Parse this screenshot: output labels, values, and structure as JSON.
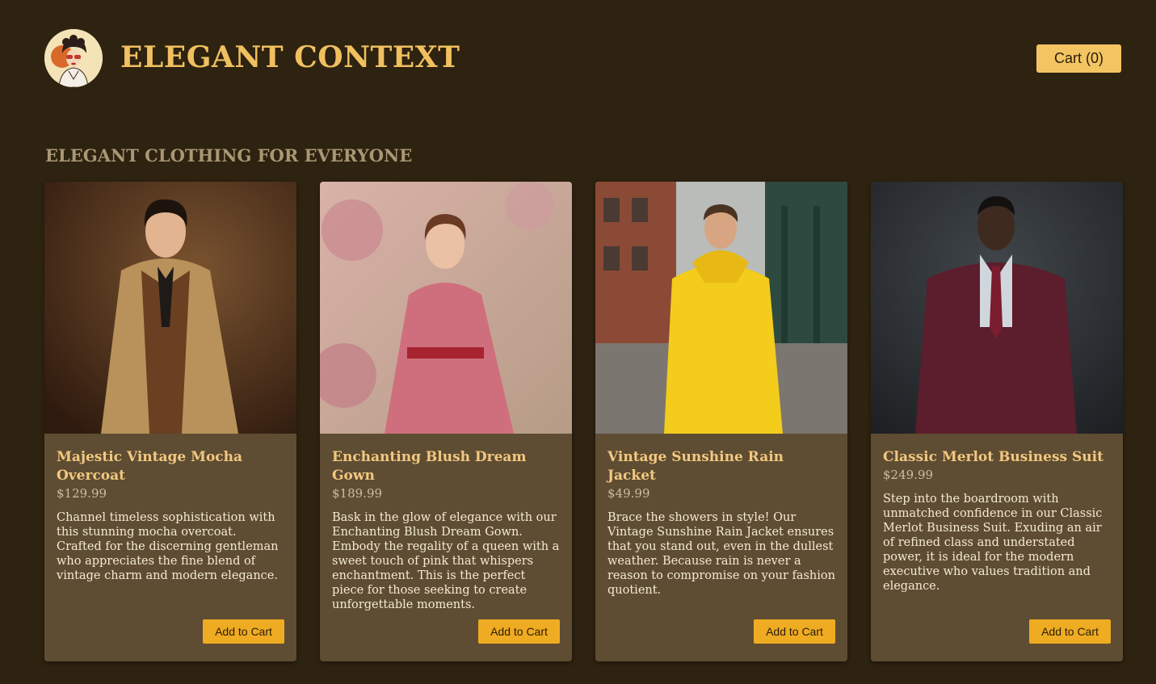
{
  "header": {
    "brand": "ELEGANT CONTEXT",
    "logo_icon": "vintage-woman-avatar",
    "cart_label": "Cart (0)"
  },
  "section_title": "ELEGANT CLOTHING FOR EVERYONE",
  "products": [
    {
      "title": "Majestic Vintage Mocha Overcoat",
      "price": "$129.99",
      "description": "Channel timeless sophistication with this stunning mocha overcoat. Crafted for the discerning gentleman who appreciates the fine blend of vintage charm and modern elegance.",
      "button": "Add to Cart"
    },
    {
      "title": "Enchanting Blush Dream Gown",
      "price": "$189.99",
      "description": "Bask in the glow of elegance with our Enchanting Blush Dream Gown. Embody the regality of a queen with a sweet touch of pink that whispers enchantment. This is the perfect piece for those seeking to create unforgettable moments.",
      "button": "Add to Cart"
    },
    {
      "title": "Vintage Sunshine Rain Jacket",
      "price": "$49.99",
      "description": "Brace the showers in style! Our Vintage Sunshine Rain Jacket ensures that you stand out, even in the dullest weather. Because rain is never a reason to compromise on your fashion quotient.",
      "button": "Add to Cart"
    },
    {
      "title": "Classic Merlot Business Suit",
      "price": "$249.99",
      "description": "Step into the boardroom with unmatched confidence in our Classic Merlot Business Suit. Exuding an air of refined class and understated power, it is ideal for the modern executive who values tradition and elegance.",
      "button": "Add to Cart"
    }
  ],
  "colors": {
    "background": "#2e2210",
    "card": "#5e4d32",
    "accent": "#f0c060",
    "button": "#efab21"
  }
}
